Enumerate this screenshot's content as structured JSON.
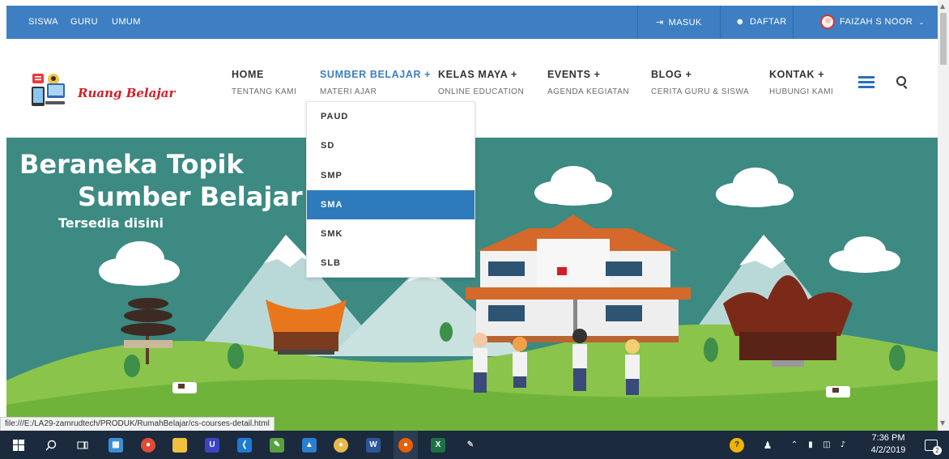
{
  "topbar": {
    "links": [
      "SISWA",
      "GURU",
      "UMUM"
    ],
    "login_label": "MASUK",
    "register_label": "DAFTAR",
    "user_label": "FAIZAH S NOOR",
    "bg_color": "#3d7fc2"
  },
  "logo": {
    "text": "Ruang Belajar"
  },
  "nav": [
    {
      "title": "HOME",
      "sub": "TENTANG KAMI"
    },
    {
      "title": "SUMBER BELAJAR  +",
      "sub": "MATERI AJAR"
    },
    {
      "title": "KELAS MAYA  +",
      "sub": "ONLINE EDUCATION"
    },
    {
      "title": "EVENTS  +",
      "sub": "AGENDA KEGIATAN"
    },
    {
      "title": "BLOG  +",
      "sub": "CERITA GURU & SISWA"
    },
    {
      "title": "KONTAK  +",
      "sub": "HUBUNGI KAMI"
    }
  ],
  "dropdown": {
    "items": [
      "PAUD",
      "SD",
      "SMP",
      "SMA",
      "SMK",
      "SLB"
    ],
    "selected": "SMA"
  },
  "hero": {
    "line1": "Beraneka Topik",
    "line2": "Sumber Belajar",
    "line3": "Tersedia disini"
  },
  "status_url": "file:///E:/LA29-zamrudtech/PRODUK/RumahBelajar/cs-courses-detail.html",
  "taskbar": {
    "time": "7:36 PM",
    "date": "4/2/2019",
    "notification_count": "2"
  }
}
